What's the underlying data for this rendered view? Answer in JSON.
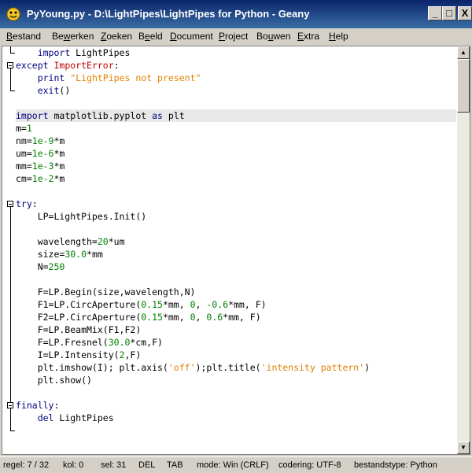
{
  "window": {
    "title": "PyYoung.py - D:\\LightPipes\\LightPipes for Python - Geany",
    "buttons": {
      "minimize": "_",
      "maximize": "□",
      "close": "X"
    }
  },
  "menu": [
    {
      "label": "Bestand",
      "mnemonic": "B"
    },
    {
      "label": "Bewerken",
      "mnemonic": "w"
    },
    {
      "label": "Zoeken",
      "mnemonic": "Z"
    },
    {
      "label": "Beeld",
      "mnemonic": "e"
    },
    {
      "label": "Document",
      "mnemonic": "D"
    },
    {
      "label": "Project",
      "mnemonic": "P"
    },
    {
      "label": "Bouwen",
      "mnemonic": "u"
    },
    {
      "label": "Extra",
      "mnemonic": "E"
    },
    {
      "label": "Help",
      "mnemonic": "H"
    }
  ],
  "code_lines": [
    [
      [
        "plain",
        "    "
      ],
      [
        "kw",
        "import"
      ],
      [
        "plain",
        " LightPipes"
      ]
    ],
    [
      [
        "kw",
        "except"
      ],
      [
        "plain",
        " "
      ],
      [
        "err",
        "ImportError"
      ],
      [
        "plain",
        ":"
      ]
    ],
    [
      [
        "plain",
        "    "
      ],
      [
        "kw",
        "print"
      ],
      [
        "plain",
        " "
      ],
      [
        "str",
        "\"LightPipes not present\""
      ]
    ],
    [
      [
        "plain",
        "    "
      ],
      [
        "kw",
        "exit"
      ],
      [
        "plain",
        "()"
      ]
    ],
    [],
    [
      [
        "kw",
        "import"
      ],
      [
        "plain",
        " matplotlib.pyplot "
      ],
      [
        "kw",
        "as"
      ],
      [
        "plain",
        " plt"
      ]
    ],
    [
      [
        "plain",
        "m="
      ],
      [
        "num",
        "1"
      ]
    ],
    [
      [
        "plain",
        "nm="
      ],
      [
        "num",
        "1e-9"
      ],
      [
        "plain",
        "*m"
      ]
    ],
    [
      [
        "plain",
        "um="
      ],
      [
        "num",
        "1e-6"
      ],
      [
        "plain",
        "*m"
      ]
    ],
    [
      [
        "plain",
        "mm="
      ],
      [
        "num",
        "1e-3"
      ],
      [
        "plain",
        "*m"
      ]
    ],
    [
      [
        "plain",
        "cm="
      ],
      [
        "num",
        "1e-2"
      ],
      [
        "plain",
        "*m"
      ]
    ],
    [],
    [
      [
        "kw",
        "try"
      ],
      [
        "plain",
        ":"
      ]
    ],
    [
      [
        "plain",
        "    LP=LightPipes.Init()"
      ]
    ],
    [],
    [
      [
        "plain",
        "    wavelength="
      ],
      [
        "num",
        "20"
      ],
      [
        "plain",
        "*um"
      ]
    ],
    [
      [
        "plain",
        "    size="
      ],
      [
        "num",
        "30.0"
      ],
      [
        "plain",
        "*mm"
      ]
    ],
    [
      [
        "plain",
        "    N="
      ],
      [
        "num",
        "250"
      ]
    ],
    [],
    [
      [
        "plain",
        "    F=LP.Begin(size,wavelength,N)"
      ]
    ],
    [
      [
        "plain",
        "    F1=LP.CircAperture("
      ],
      [
        "num",
        "0.15"
      ],
      [
        "plain",
        "*mm, "
      ],
      [
        "num",
        "0"
      ],
      [
        "plain",
        ", "
      ],
      [
        "num",
        "-0.6"
      ],
      [
        "plain",
        "*mm, F)"
      ]
    ],
    [
      [
        "plain",
        "    F2=LP.CircAperture("
      ],
      [
        "num",
        "0.15"
      ],
      [
        "plain",
        "*mm, "
      ],
      [
        "num",
        "0"
      ],
      [
        "plain",
        ", "
      ],
      [
        "num",
        "0.6"
      ],
      [
        "plain",
        "*mm, F)"
      ]
    ],
    [
      [
        "plain",
        "    F=LP.BeamMix(F1,F2)"
      ]
    ],
    [
      [
        "plain",
        "    F=LP.Fresnel("
      ],
      [
        "num",
        "30.0"
      ],
      [
        "plain",
        "*cm,F)"
      ]
    ],
    [
      [
        "plain",
        "    I=LP.Intensity("
      ],
      [
        "num",
        "2"
      ],
      [
        "plain",
        ",F)"
      ]
    ],
    [
      [
        "plain",
        "    plt.imshow(I); plt.axis("
      ],
      [
        "str",
        "'off'"
      ],
      [
        "plain",
        ");plt.title("
      ],
      [
        "str",
        "'intensity pattern'"
      ],
      [
        "plain",
        ")"
      ]
    ],
    [
      [
        "plain",
        "    plt.show()"
      ]
    ],
    [],
    [
      [
        "kw",
        "finally"
      ],
      [
        "plain",
        ":"
      ]
    ],
    [
      [
        "plain",
        "    "
      ],
      [
        "kw",
        "del"
      ],
      [
        "plain",
        " LightPipes"
      ]
    ]
  ],
  "colors": {
    "keyword": "#00007f",
    "error_class": "#c00000",
    "string": "#e08000",
    "number": "#007f00"
  },
  "status": {
    "line": "regel: 7 / 32",
    "col": "kol: 0",
    "sel": "sel: 31",
    "ins": "DEL",
    "tab": "TAB",
    "mode": "mode: Win (CRLF)",
    "encoding": "codering: UTF-8",
    "filetype": "bestandstype: Python"
  }
}
